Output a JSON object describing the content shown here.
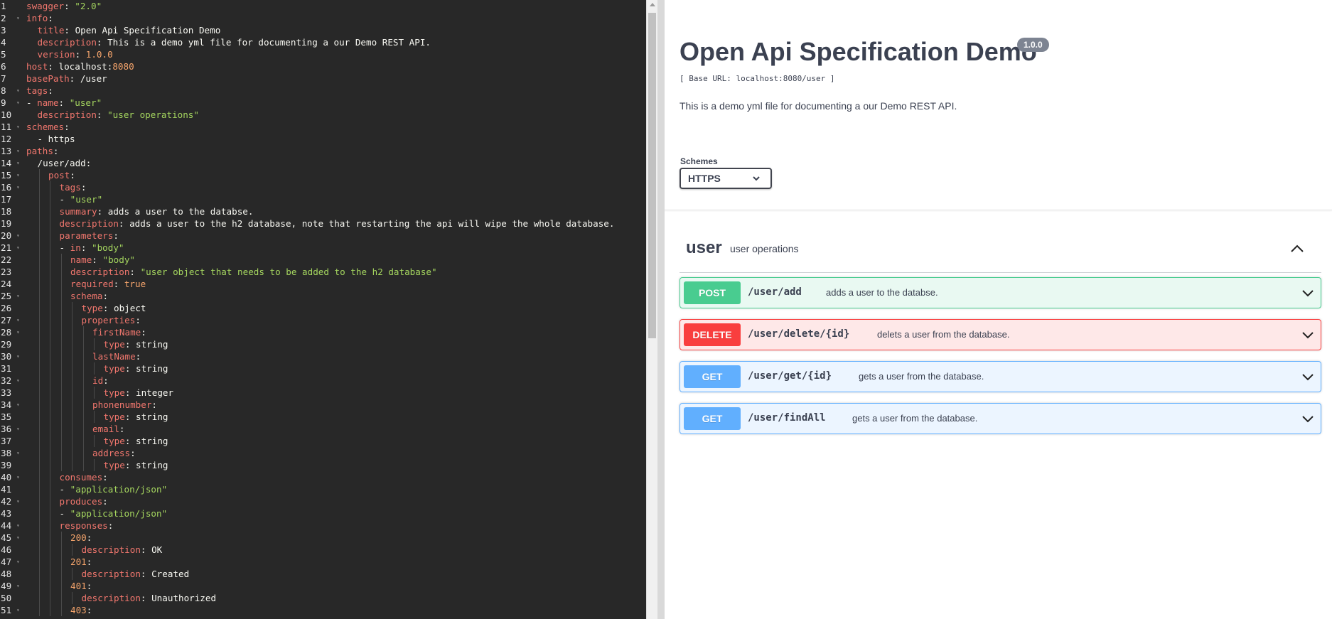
{
  "editor": {
    "lines": [
      {
        "n": "1",
        "fold": false,
        "indent": 0,
        "parts": [
          [
            "k",
            "swagger"
          ],
          [
            "p",
            ": "
          ],
          [
            "s",
            "\"2.0\""
          ]
        ]
      },
      {
        "n": "2",
        "fold": true,
        "indent": 0,
        "parts": [
          [
            "k",
            "info"
          ],
          [
            "p",
            ":"
          ]
        ]
      },
      {
        "n": "3",
        "fold": false,
        "indent": 1,
        "parts": [
          [
            "k",
            "title"
          ],
          [
            "p",
            ": Open Api Specification Demo"
          ]
        ]
      },
      {
        "n": "4",
        "fold": false,
        "indent": 1,
        "parts": [
          [
            "k",
            "description"
          ],
          [
            "p",
            ": This is a demo yml file for documenting a our Demo REST API."
          ]
        ]
      },
      {
        "n": "5",
        "fold": false,
        "indent": 1,
        "parts": [
          [
            "k",
            "version"
          ],
          [
            "p",
            ": "
          ],
          [
            "n",
            "1.0.0"
          ]
        ]
      },
      {
        "n": "6",
        "fold": false,
        "indent": 0,
        "parts": [
          [
            "k",
            "host"
          ],
          [
            "p",
            ": localhost:"
          ],
          [
            "n",
            "8080"
          ]
        ]
      },
      {
        "n": "7",
        "fold": false,
        "indent": 0,
        "parts": [
          [
            "k",
            "basePath"
          ],
          [
            "p",
            ": /user"
          ]
        ]
      },
      {
        "n": "8",
        "fold": true,
        "indent": 0,
        "parts": [
          [
            "k",
            "tags"
          ],
          [
            "p",
            ":"
          ]
        ]
      },
      {
        "n": "9",
        "fold": true,
        "indent": 0,
        "parts": [
          [
            "p",
            "- "
          ],
          [
            "k",
            "name"
          ],
          [
            "p",
            ": "
          ],
          [
            "s",
            "\"user\""
          ]
        ]
      },
      {
        "n": "10",
        "fold": false,
        "indent": 1,
        "parts": [
          [
            "k",
            "description"
          ],
          [
            "p",
            ": "
          ],
          [
            "s",
            "\"user operations\""
          ]
        ]
      },
      {
        "n": "11",
        "fold": true,
        "indent": 0,
        "parts": [
          [
            "k",
            "schemes"
          ],
          [
            "p",
            ":"
          ]
        ]
      },
      {
        "n": "12",
        "fold": false,
        "indent": 1,
        "parts": [
          [
            "p",
            "- https"
          ]
        ]
      },
      {
        "n": "13",
        "fold": true,
        "indent": 0,
        "parts": [
          [
            "k",
            "paths"
          ],
          [
            "p",
            ":"
          ]
        ]
      },
      {
        "n": "14",
        "fold": true,
        "indent": 1,
        "parts": [
          [
            "p",
            "/user/add:"
          ]
        ]
      },
      {
        "n": "15",
        "fold": true,
        "indent": 2,
        "parts": [
          [
            "k",
            "post"
          ],
          [
            "p",
            ":"
          ]
        ]
      },
      {
        "n": "16",
        "fold": true,
        "indent": 3,
        "parts": [
          [
            "k",
            "tags"
          ],
          [
            "p",
            ":"
          ]
        ]
      },
      {
        "n": "17",
        "fold": false,
        "indent": 3,
        "parts": [
          [
            "p",
            "- "
          ],
          [
            "s",
            "\"user\""
          ]
        ]
      },
      {
        "n": "18",
        "fold": false,
        "indent": 3,
        "parts": [
          [
            "k",
            "summary"
          ],
          [
            "p",
            ": adds a user to the databse."
          ]
        ]
      },
      {
        "n": "19",
        "fold": false,
        "indent": 3,
        "parts": [
          [
            "k",
            "description"
          ],
          [
            "p",
            ": adds a user to the h2 database, note that restarting the api will wipe the whole database."
          ]
        ]
      },
      {
        "n": "20",
        "fold": true,
        "indent": 3,
        "parts": [
          [
            "k",
            "parameters"
          ],
          [
            "p",
            ":"
          ]
        ]
      },
      {
        "n": "21",
        "fold": true,
        "indent": 3,
        "parts": [
          [
            "p",
            "- "
          ],
          [
            "k",
            "in"
          ],
          [
            "p",
            ": "
          ],
          [
            "s",
            "\"body\""
          ]
        ]
      },
      {
        "n": "22",
        "fold": false,
        "indent": 4,
        "parts": [
          [
            "k",
            "name"
          ],
          [
            "p",
            ": "
          ],
          [
            "s",
            "\"body\""
          ]
        ]
      },
      {
        "n": "23",
        "fold": false,
        "indent": 4,
        "parts": [
          [
            "k",
            "description"
          ],
          [
            "p",
            ": "
          ],
          [
            "s",
            "\"user object that needs to be added to the h2 database\""
          ]
        ]
      },
      {
        "n": "24",
        "fold": false,
        "indent": 4,
        "parts": [
          [
            "k",
            "required"
          ],
          [
            "p",
            ": "
          ],
          [
            "n",
            "true"
          ]
        ]
      },
      {
        "n": "25",
        "fold": true,
        "indent": 4,
        "parts": [
          [
            "k",
            "schema"
          ],
          [
            "p",
            ":"
          ]
        ]
      },
      {
        "n": "26",
        "fold": false,
        "indent": 5,
        "parts": [
          [
            "k",
            "type"
          ],
          [
            "p",
            ": object"
          ]
        ]
      },
      {
        "n": "27",
        "fold": true,
        "indent": 5,
        "parts": [
          [
            "k",
            "properties"
          ],
          [
            "p",
            ":"
          ]
        ]
      },
      {
        "n": "28",
        "fold": true,
        "indent": 6,
        "parts": [
          [
            "k",
            "firstName"
          ],
          [
            "p",
            ":"
          ]
        ]
      },
      {
        "n": "29",
        "fold": false,
        "indent": 7,
        "parts": [
          [
            "k",
            "type"
          ],
          [
            "p",
            ": string"
          ]
        ]
      },
      {
        "n": "30",
        "fold": true,
        "indent": 6,
        "parts": [
          [
            "k",
            "lastName"
          ],
          [
            "p",
            ":"
          ]
        ]
      },
      {
        "n": "31",
        "fold": false,
        "indent": 7,
        "parts": [
          [
            "k",
            "type"
          ],
          [
            "p",
            ": string"
          ]
        ]
      },
      {
        "n": "32",
        "fold": true,
        "indent": 6,
        "parts": [
          [
            "k",
            "id"
          ],
          [
            "p",
            ":"
          ]
        ]
      },
      {
        "n": "33",
        "fold": false,
        "indent": 7,
        "parts": [
          [
            "k",
            "type"
          ],
          [
            "p",
            ": integer"
          ]
        ]
      },
      {
        "n": "34",
        "fold": true,
        "indent": 6,
        "parts": [
          [
            "k",
            "phonenumber"
          ],
          [
            "p",
            ":"
          ]
        ]
      },
      {
        "n": "35",
        "fold": false,
        "indent": 7,
        "parts": [
          [
            "k",
            "type"
          ],
          [
            "p",
            ": string"
          ]
        ]
      },
      {
        "n": "36",
        "fold": true,
        "indent": 6,
        "parts": [
          [
            "k",
            "email"
          ],
          [
            "p",
            ":"
          ]
        ]
      },
      {
        "n": "37",
        "fold": false,
        "indent": 7,
        "parts": [
          [
            "k",
            "type"
          ],
          [
            "p",
            ": string"
          ]
        ]
      },
      {
        "n": "38",
        "fold": true,
        "indent": 6,
        "parts": [
          [
            "k",
            "address"
          ],
          [
            "p",
            ":"
          ]
        ]
      },
      {
        "n": "39",
        "fold": false,
        "indent": 7,
        "parts": [
          [
            "k",
            "type"
          ],
          [
            "p",
            ": string"
          ]
        ]
      },
      {
        "n": "40",
        "fold": true,
        "indent": 3,
        "parts": [
          [
            "k",
            "consumes"
          ],
          [
            "p",
            ":"
          ]
        ]
      },
      {
        "n": "41",
        "fold": false,
        "indent": 3,
        "parts": [
          [
            "p",
            "- "
          ],
          [
            "s",
            "\"application/json\""
          ]
        ]
      },
      {
        "n": "42",
        "fold": true,
        "indent": 3,
        "parts": [
          [
            "k",
            "produces"
          ],
          [
            "p",
            ":"
          ]
        ]
      },
      {
        "n": "43",
        "fold": false,
        "indent": 3,
        "parts": [
          [
            "p",
            "- "
          ],
          [
            "s",
            "\"application/json\""
          ]
        ]
      },
      {
        "n": "44",
        "fold": true,
        "indent": 3,
        "parts": [
          [
            "k",
            "responses"
          ],
          [
            "p",
            ":"
          ]
        ]
      },
      {
        "n": "45",
        "fold": true,
        "indent": 4,
        "parts": [
          [
            "n",
            "200"
          ],
          [
            "p",
            ":"
          ]
        ]
      },
      {
        "n": "46",
        "fold": false,
        "indent": 5,
        "parts": [
          [
            "k",
            "description"
          ],
          [
            "p",
            ": OK"
          ]
        ]
      },
      {
        "n": "47",
        "fold": true,
        "indent": 4,
        "parts": [
          [
            "n",
            "201"
          ],
          [
            "p",
            ":"
          ]
        ]
      },
      {
        "n": "48",
        "fold": false,
        "indent": 5,
        "parts": [
          [
            "k",
            "description"
          ],
          [
            "p",
            ": Created"
          ]
        ]
      },
      {
        "n": "49",
        "fold": true,
        "indent": 4,
        "parts": [
          [
            "n",
            "401"
          ],
          [
            "p",
            ":"
          ]
        ]
      },
      {
        "n": "50",
        "fold": false,
        "indent": 5,
        "parts": [
          [
            "k",
            "description"
          ],
          [
            "p",
            ": Unauthorized"
          ]
        ]
      },
      {
        "n": "51",
        "fold": true,
        "indent": 4,
        "parts": [
          [
            "n",
            "403"
          ],
          [
            "p",
            ":"
          ]
        ]
      }
    ]
  },
  "info": {
    "title": "Open Api Specification Demo",
    "version": "1.0.0",
    "base_url": "[ Base URL: localhost:8080/user ]",
    "description": "This is a demo yml file for documenting a our Demo REST API."
  },
  "schemes": {
    "label": "Schemes",
    "selected": "HTTPS"
  },
  "tag": {
    "name": "user",
    "description": "user operations"
  },
  "operations": [
    {
      "method": "POST",
      "path": "/user/add",
      "summary": "adds a user to the databse."
    },
    {
      "method": "DELETE",
      "path": "/user/delete/{id}",
      "summary": "delets a user from the database."
    },
    {
      "method": "GET",
      "path": "/user/get/{id}",
      "summary": "gets a user from the database."
    },
    {
      "method": "GET",
      "path": "/user/findAll",
      "summary": "gets a user from the database."
    }
  ],
  "colors": {
    "editor_bg": "#282828",
    "post": "#49cc90",
    "delete": "#f93e3e",
    "get": "#61affe",
    "text": "#3b4151"
  }
}
